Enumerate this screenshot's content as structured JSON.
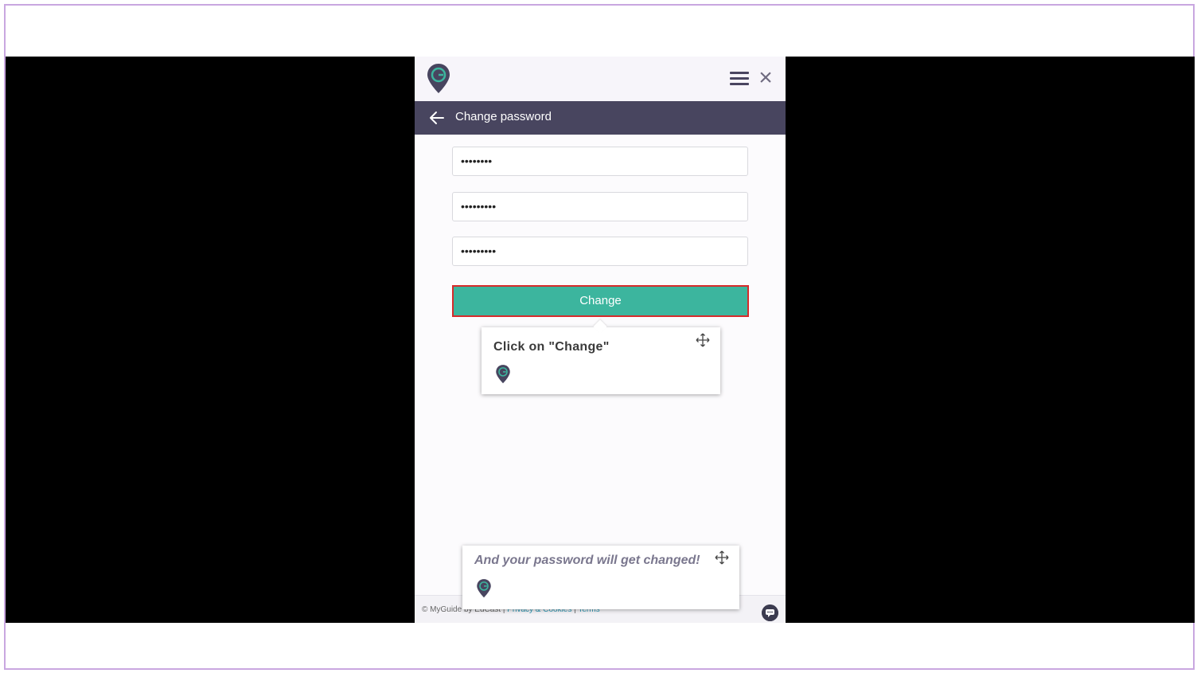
{
  "panel": {
    "title": "Change password",
    "fields": [
      {
        "value": "••••••••"
      },
      {
        "value": "•••••••••"
      },
      {
        "value": "•••••••••"
      }
    ],
    "change_button_label": "Change"
  },
  "tooltip_step": {
    "text": "Click on \"Change\""
  },
  "tooltip_final": {
    "text": "And your password will get changed!"
  },
  "footer": {
    "copyright": "© MyGuide by EdCast",
    "sep1": " | ",
    "privacy_link": "Privacy & Cookies",
    "sep2": " | ",
    "terms_link": "Terms"
  },
  "colors": {
    "accent": "#3cb59e",
    "header_bar": "#48455f",
    "highlight_border": "#d62b2b"
  }
}
